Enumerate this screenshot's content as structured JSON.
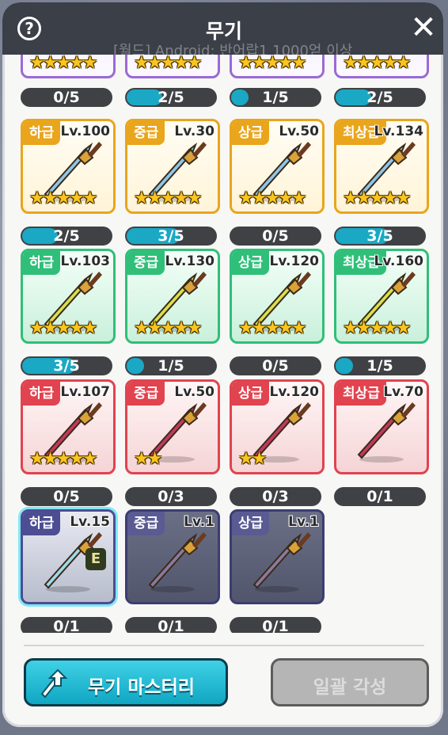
{
  "window": {
    "title": "무기",
    "help_label": "?",
    "close_label": "✕",
    "banner_text": "[월드] Android: 반어랍1 1000얻 이상"
  },
  "colors": {
    "lower": "#e9a51c",
    "green": "#2fbf79",
    "red": "#e1434f",
    "blue": "#4c4d93",
    "purple": "#9b6ad2"
  },
  "top_bars": [
    {
      "label": "0/5",
      "progress": 0.0
    },
    {
      "label": "2/5",
      "progress": 0.4
    },
    {
      "label": "1/5",
      "progress": 0.2
    },
    {
      "label": "2/5",
      "progress": 0.4
    }
  ],
  "weapons": [
    {
      "grade": "하급",
      "level": "Lv.100",
      "stars": "★★★★★",
      "count": "2/5",
      "progress": 0.4,
      "tier": "gold"
    },
    {
      "grade": "중급",
      "level": "Lv.30",
      "stars": "★★★★★",
      "count": "3/5",
      "progress": 0.6,
      "tier": "gold"
    },
    {
      "grade": "상급",
      "level": "Lv.50",
      "stars": "★★★★★",
      "count": "0/5",
      "progress": 0.0,
      "tier": "gold"
    },
    {
      "grade": "최상급",
      "level": "Lv.134",
      "stars": "★★★★★",
      "count": "3/5",
      "progress": 0.6,
      "tier": "gold"
    },
    {
      "grade": "하급",
      "level": "Lv.103",
      "stars": "★★★★★",
      "count": "3/5",
      "progress": 0.6,
      "tier": "green"
    },
    {
      "grade": "중급",
      "level": "Lv.130",
      "stars": "★★★★★",
      "count": "1/5",
      "progress": 0.2,
      "tier": "green"
    },
    {
      "grade": "상급",
      "level": "Lv.120",
      "stars": "★★★★★",
      "count": "0/5",
      "progress": 0.0,
      "tier": "green"
    },
    {
      "grade": "최상급",
      "level": "Lv.160",
      "stars": "★★★★★",
      "count": "1/5",
      "progress": 0.2,
      "tier": "green"
    },
    {
      "grade": "하급",
      "level": "Lv.107",
      "stars": "★★★★★",
      "count": "0/5",
      "progress": 0.0,
      "tier": "red"
    },
    {
      "grade": "중급",
      "level": "Lv.50",
      "stars": "★★",
      "count": "0/3",
      "progress": 0.0,
      "tier": "red"
    },
    {
      "grade": "상급",
      "level": "Lv.120",
      "stars": "★★",
      "count": "0/3",
      "progress": 0.0,
      "tier": "red"
    },
    {
      "grade": "최상급",
      "level": "Lv.70",
      "stars": "",
      "count": "0/1",
      "progress": 0.0,
      "tier": "red"
    },
    {
      "grade": "하급",
      "level": "Lv.15",
      "stars": "",
      "count": "0/1",
      "progress": 0.0,
      "tier": "blue",
      "equipped": "E"
    },
    {
      "grade": "중급",
      "level": "Lv.1",
      "stars": "",
      "count": "0/1",
      "progress": 0.0,
      "tier": "blue-locked"
    },
    {
      "grade": "상급",
      "level": "Lv.1",
      "stars": "",
      "count": "0/1",
      "progress": 0.0,
      "tier": "blue-locked"
    }
  ],
  "buttons": {
    "master_label": "무기 마스터리",
    "awaken_label": "일괄 각성"
  }
}
